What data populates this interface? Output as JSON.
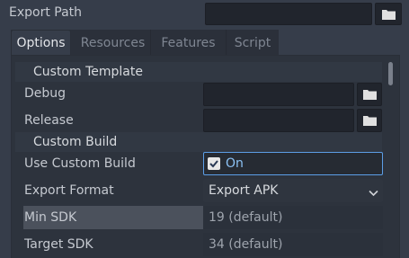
{
  "header": {
    "export_path_label": "Export Path",
    "export_path_value": ""
  },
  "tabs": [
    {
      "label": "Options",
      "active": true
    },
    {
      "label": "Resources",
      "active": false
    },
    {
      "label": "Features",
      "active": false
    },
    {
      "label": "Script",
      "active": false
    }
  ],
  "sections": {
    "custom_template": "Custom Template",
    "custom_build": "Custom Build"
  },
  "props": {
    "debug": {
      "label": "Debug",
      "value": ""
    },
    "release": {
      "label": "Release",
      "value": ""
    },
    "use_custom_build": {
      "label": "Use Custom Build",
      "value": "On",
      "checked": true
    },
    "export_format": {
      "label": "Export Format",
      "value": "Export APK"
    },
    "min_sdk": {
      "label": "Min SDK",
      "placeholder": "19 (default)"
    },
    "target_sdk": {
      "label": "Target SDK",
      "placeholder": "34 (default)"
    }
  },
  "colors": {
    "accent": "#5c9ee6",
    "background": "#363d4a",
    "panel": "#2d333d",
    "field": "#21252d"
  }
}
